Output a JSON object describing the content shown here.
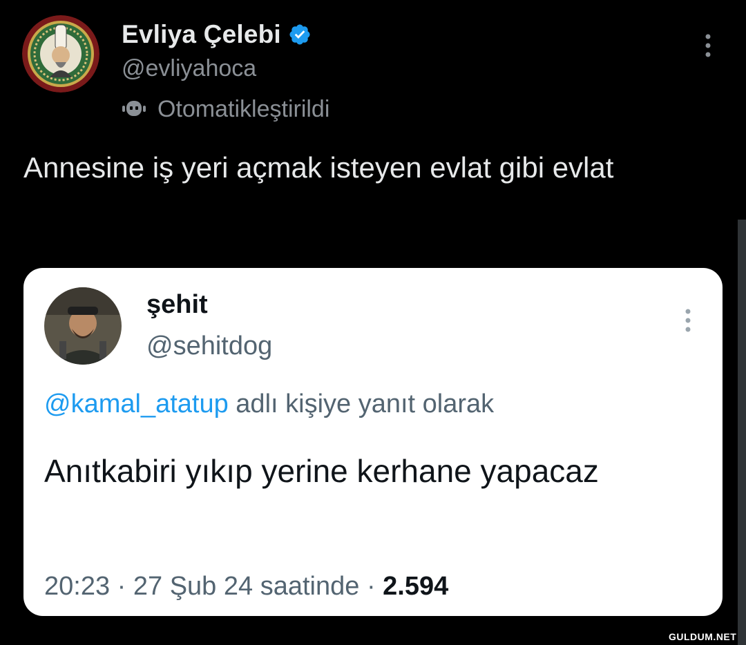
{
  "tweet": {
    "author": {
      "display_name": "Evliya Çelebi",
      "handle": "@evliyahoca",
      "verified": true,
      "avatar_icon": "ottoman-seal-avatar",
      "automated_label": "Otomatikleştirildi",
      "automated_icon": "bot-icon"
    },
    "text": "Annesine iş yeri açmak isteyen evlat gibi evlat",
    "more_icon": "more-vertical-icon"
  },
  "quoted": {
    "author": {
      "display_name": "şehit",
      "handle": "@sehitdog",
      "avatar_icon": "profile-photo-avatar"
    },
    "reply_mention": "@kamal_atatup",
    "reply_suffix": "adlı kişiye yanıt olarak",
    "text": "Anıtkabiri yıkıp yerine kerhane yapacaz",
    "time": "20:23",
    "separator": "·",
    "date": "27 Şub 24 saatinde",
    "views": "2.594",
    "more_icon": "more-vertical-icon"
  },
  "watermark": "GULDUM.NET",
  "colors": {
    "background": "#000000",
    "verified_blue": "#1d9bf0",
    "link_blue": "#1d9bf0",
    "muted_text_dark": "#8b9096",
    "muted_text_light": "#536471"
  }
}
